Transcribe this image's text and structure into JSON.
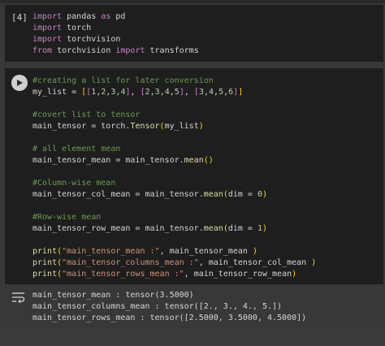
{
  "cell1": {
    "execution_count": "[4]",
    "lines": [
      [
        {
          "t": "import",
          "c": "kw"
        },
        {
          "t": " pandas ",
          "c": "txt"
        },
        {
          "t": "as",
          "c": "kw"
        },
        {
          "t": " pd",
          "c": "txt"
        }
      ],
      [
        {
          "t": "import",
          "c": "kw"
        },
        {
          "t": " torch",
          "c": "txt"
        }
      ],
      [
        {
          "t": "import",
          "c": "kw"
        },
        {
          "t": " torchvision",
          "c": "txt"
        }
      ],
      [
        {
          "t": "from",
          "c": "kw"
        },
        {
          "t": " torchvision ",
          "c": "txt"
        },
        {
          "t": "import",
          "c": "kw"
        },
        {
          "t": " transforms",
          "c": "txt"
        }
      ]
    ]
  },
  "cell2": {
    "run_button_icon": "play-icon",
    "lines": [
      [
        {
          "t": "#creating a list for later conversion",
          "c": "com"
        }
      ],
      [
        {
          "t": "my_list = ",
          "c": "txt"
        },
        {
          "t": "[",
          "c": "br-y"
        },
        {
          "t": "[",
          "c": "br-p"
        },
        {
          "t": "1",
          "c": "num"
        },
        {
          "t": ",",
          "c": "txt"
        },
        {
          "t": "2",
          "c": "num"
        },
        {
          "t": ",",
          "c": "txt"
        },
        {
          "t": "3",
          "c": "num"
        },
        {
          "t": ",",
          "c": "txt"
        },
        {
          "t": "4",
          "c": "num"
        },
        {
          "t": "]",
          "c": "br-p"
        },
        {
          "t": ", ",
          "c": "txt"
        },
        {
          "t": "[",
          "c": "br-p"
        },
        {
          "t": "2",
          "c": "num"
        },
        {
          "t": ",",
          "c": "txt"
        },
        {
          "t": "3",
          "c": "num"
        },
        {
          "t": ",",
          "c": "txt"
        },
        {
          "t": "4",
          "c": "num"
        },
        {
          "t": ",",
          "c": "txt"
        },
        {
          "t": "5",
          "c": "num"
        },
        {
          "t": "]",
          "c": "br-p"
        },
        {
          "t": ", ",
          "c": "txt"
        },
        {
          "t": "[",
          "c": "br-p"
        },
        {
          "t": "3",
          "c": "num"
        },
        {
          "t": ",",
          "c": "txt"
        },
        {
          "t": "4",
          "c": "num"
        },
        {
          "t": ",",
          "c": "txt"
        },
        {
          "t": "5",
          "c": "num"
        },
        {
          "t": ",",
          "c": "txt"
        },
        {
          "t": "6",
          "c": "num"
        },
        {
          "t": "]",
          "c": "br-p"
        },
        {
          "t": "]",
          "c": "br-y"
        }
      ],
      [],
      [
        {
          "t": "#covert list to tensor",
          "c": "com"
        }
      ],
      [
        {
          "t": "main_tensor = torch.",
          "c": "txt"
        },
        {
          "t": "Tensor",
          "c": "fn"
        },
        {
          "t": "(",
          "c": "br-y"
        },
        {
          "t": "my_list",
          "c": "txt"
        },
        {
          "t": ")",
          "c": "br-y"
        }
      ],
      [],
      [
        {
          "t": "# all element mean",
          "c": "com"
        }
      ],
      [
        {
          "t": "main_tensor_mean = main_tensor.",
          "c": "txt"
        },
        {
          "t": "mean",
          "c": "fn"
        },
        {
          "t": "()",
          "c": "br-y"
        }
      ],
      [],
      [
        {
          "t": "#Column-wise mean",
          "c": "com"
        }
      ],
      [
        {
          "t": "main_tensor_col_mean = main_tensor.",
          "c": "txt"
        },
        {
          "t": "mean",
          "c": "fn"
        },
        {
          "t": "(",
          "c": "br-y"
        },
        {
          "t": "dim = ",
          "c": "txt"
        },
        {
          "t": "0",
          "c": "num"
        },
        {
          "t": ")",
          "c": "br-y"
        }
      ],
      [],
      [
        {
          "t": "#Row-wise mean",
          "c": "com"
        }
      ],
      [
        {
          "t": "main_tensor_row_mean = main_tensor.",
          "c": "txt"
        },
        {
          "t": "mean",
          "c": "fn"
        },
        {
          "t": "(",
          "c": "br-y"
        },
        {
          "t": "dim = ",
          "c": "txt"
        },
        {
          "t": "1",
          "c": "num"
        },
        {
          "t": ")",
          "c": "br-y"
        }
      ],
      [],
      [
        {
          "t": "print",
          "c": "fn"
        },
        {
          "t": "(",
          "c": "br-y"
        },
        {
          "t": "\"main_tensor_mean :\"",
          "c": "str"
        },
        {
          "t": ", main_tensor_mean ",
          "c": "txt"
        },
        {
          "t": ")",
          "c": "br-y"
        }
      ],
      [
        {
          "t": "print",
          "c": "fn"
        },
        {
          "t": "(",
          "c": "br-y"
        },
        {
          "t": "\"main_tensor_columns_mean :\"",
          "c": "str"
        },
        {
          "t": ", main_tensor_col_mean ",
          "c": "txt"
        },
        {
          "t": ")",
          "c": "br-y"
        }
      ],
      [
        {
          "t": "print",
          "c": "fn"
        },
        {
          "t": "(",
          "c": "br-y"
        },
        {
          "t": "\"main_tensor_rows_mean :\"",
          "c": "str"
        },
        {
          "t": ", main_tensor_row_mean",
          "c": "txt"
        },
        {
          "t": ")",
          "c": "br-y"
        }
      ]
    ]
  },
  "output": {
    "icon": "output-toggle-icon",
    "lines": [
      "main_tensor_mean : tensor(3.5000)",
      "main_tensor_columns_mean : tensor([2., 3., 4., 5.])",
      "main_tensor_rows_mean : tensor([2.5000, 3.5000, 4.5000])"
    ]
  },
  "colors": {
    "keyword": "#c586c0",
    "function": "#dcdcaa",
    "string": "#ce9178",
    "number": "#b5cea8",
    "comment": "#6a9955",
    "cell_background": "#1e1e1e",
    "page_background": "#383838"
  }
}
